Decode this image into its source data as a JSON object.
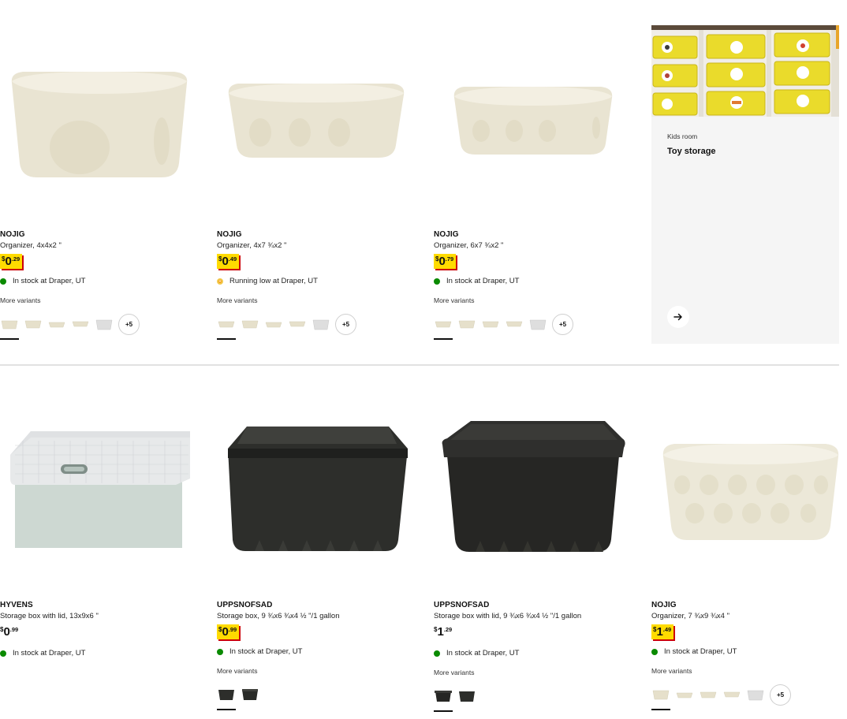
{
  "colors": {
    "family_price_bg": "#ffdb00",
    "family_price_shadow": "#cc0008",
    "in_stock": "#0a8a00",
    "low_stock": "#f5a623"
  },
  "products": [
    {
      "brand": "NOJIG",
      "desc": "Organizer, 4x4x2 \"",
      "price": {
        "currency": "$",
        "int": "0",
        "dec": ".29",
        "family": true
      },
      "stock": {
        "text": "In stock at Draper, UT",
        "status": "green"
      },
      "more_variants": "More variants",
      "more_count": "+5"
    },
    {
      "brand": "NOJIG",
      "desc": "Organizer, 4x7 ¾x2 \"",
      "price": {
        "currency": "$",
        "int": "0",
        "dec": ".49",
        "family": true
      },
      "stock": {
        "text": "Running low at Draper, UT",
        "status": "orange"
      },
      "more_variants": "More variants",
      "more_count": "+5"
    },
    {
      "brand": "NOJIG",
      "desc": "Organizer, 6x7 ¾x2 \"",
      "price": {
        "currency": "$",
        "int": "0",
        "dec": ".79",
        "family": true
      },
      "stock": {
        "text": "In stock at Draper, UT",
        "status": "green"
      },
      "more_variants": "More variants",
      "more_count": "+5"
    },
    {
      "brand": "HYVENS",
      "desc": "Storage box with lid, 13x9x6 \"",
      "price": {
        "currency": "$",
        "int": "0",
        "dec": ".99",
        "family": false
      },
      "stock": {
        "text": "In stock at Draper, UT",
        "status": "green"
      }
    },
    {
      "brand": "UPPSNOFSAD",
      "desc": "Storage box, 9 ¾x6 ¾x4 ½ \"/1 gallon",
      "price": {
        "currency": "$",
        "int": "0",
        "dec": ".99",
        "family": true
      },
      "stock": {
        "text": "In stock at Draper, UT",
        "status": "green"
      },
      "more_variants": "More variants"
    },
    {
      "brand": "UPPSNOFSAD",
      "desc": "Storage box with lid, 9 ¾x6 ¾x4 ½ \"/1 gallon",
      "price": {
        "currency": "$",
        "int": "1",
        "dec": ".29",
        "family": false
      },
      "stock": {
        "text": "In stock at Draper, UT",
        "status": "green"
      },
      "more_variants": "More variants"
    },
    {
      "brand": "NOJIG",
      "desc": "Organizer, 7 ¾x9 ¾x4 \"",
      "price": {
        "currency": "$",
        "int": "1",
        "dec": ".49",
        "family": true
      },
      "stock": {
        "text": "In stock at Draper, UT",
        "status": "green"
      },
      "more_variants": "More variants",
      "more_count": "+5"
    }
  ],
  "promo": {
    "kicker": "Kids room",
    "title": "Toy storage",
    "icon": "arrow-right-icon"
  }
}
